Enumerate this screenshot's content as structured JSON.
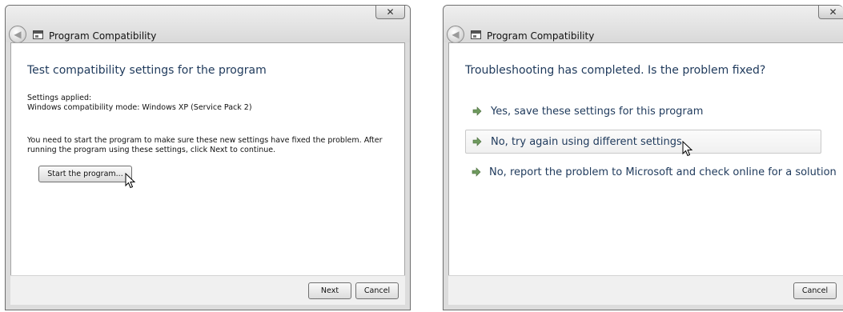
{
  "left_window": {
    "title": "Program Compatibility",
    "close_label": "✕",
    "heading": "Test compatibility settings for the program",
    "settings_applied_label": "Settings applied:",
    "settings_value": "Windows compatibility mode: Windows XP (Service Pack 2)",
    "instruction_line1": "You need to start the program to make sure these new settings have fixed the problem. After",
    "instruction_line2": "running the program using these settings, click Next to continue.",
    "start_button": "Start the program...",
    "next_button": "Next",
    "cancel_button": "Cancel"
  },
  "right_window": {
    "title": "Program Compatibility",
    "close_label": "✕",
    "heading": "Troubleshooting has completed.  Is the problem fixed?",
    "options": [
      {
        "label": "Yes, save these settings for this program"
      },
      {
        "label": "No, try again using different settings"
      },
      {
        "label": "No, report the problem to Microsoft and check online for a solution"
      }
    ],
    "cancel_button": "Cancel"
  },
  "icons": {
    "back": "back-arrow-icon",
    "app": "program-window-icon",
    "option_arrow": "green-arrow-icon",
    "cursor": "mouse-pointer-icon"
  },
  "colors": {
    "heading": "#1e395b",
    "arrow": "#2f8a1f",
    "frame": "#dcdcdc"
  }
}
